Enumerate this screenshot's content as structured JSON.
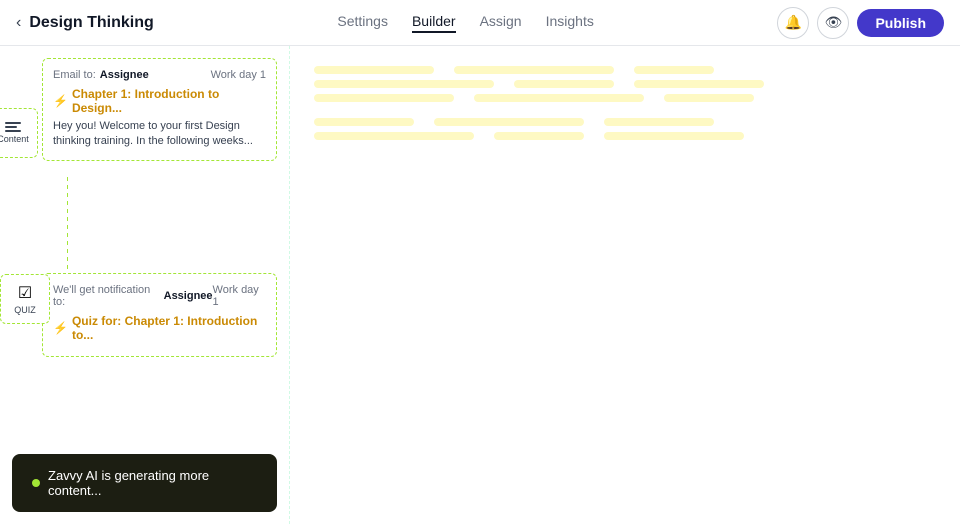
{
  "header": {
    "back_icon": "‹",
    "title": "Design Thinking",
    "nav_items": [
      {
        "label": "Settings",
        "active": false
      },
      {
        "label": "Builder",
        "active": true
      },
      {
        "label": "Assign",
        "active": false
      },
      {
        "label": "Insights",
        "active": false
      }
    ],
    "icon_buttons": [
      {
        "icon": "🔔",
        "name": "bell-icon"
      },
      {
        "icon": "👁",
        "name": "eye-icon"
      }
    ],
    "publish_label": "Publish"
  },
  "content_card": {
    "email_label": "Email to:",
    "assignee_label": "Assignee",
    "work_day_label": "Work day 1",
    "chapter_label": "Chapter 1: Introduction to Design...",
    "body_text": "Hey you! Welcome to your first Design thinking training. In the following weeks...",
    "icon_label": "Content"
  },
  "quiz_card": {
    "email_label": "We'll get notification to:",
    "assignee_label": "Assignee",
    "work_day_label": "Work day 1",
    "chapter_label": "Quiz for: Chapter 1: Introduction to...",
    "icon_label": "QUIZ"
  },
  "ai_bar": {
    "text": "Zavvy AI is generating more content..."
  },
  "skeleton": {
    "rows": [
      [
        60,
        80
      ],
      [
        90,
        50
      ],
      [
        70,
        65
      ]
    ]
  }
}
